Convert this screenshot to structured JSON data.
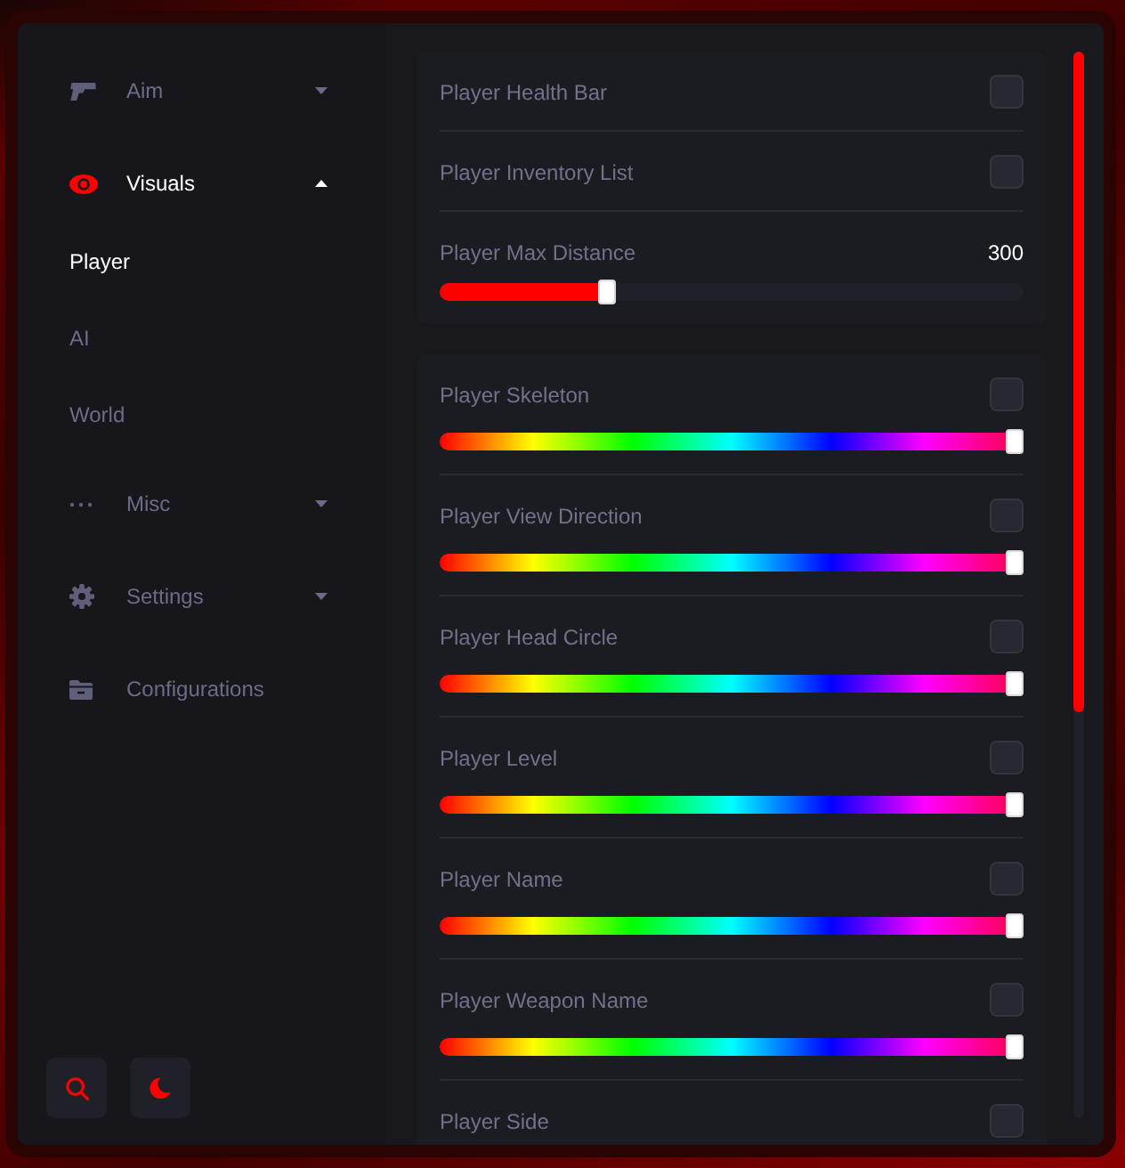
{
  "sidebar": {
    "items": [
      {
        "kind": "group",
        "label": "Aim",
        "selected": false,
        "expanded": false
      },
      {
        "kind": "group",
        "label": "Visuals",
        "selected": true,
        "expanded": true,
        "children": [
          {
            "label": "Player",
            "selected": true
          },
          {
            "label": "AI",
            "selected": false
          },
          {
            "label": "World",
            "selected": false
          }
        ]
      },
      {
        "kind": "group",
        "label": "Misc",
        "selected": false,
        "expanded": false
      },
      {
        "kind": "group",
        "label": "Settings",
        "selected": false,
        "expanded": false
      },
      {
        "kind": "link",
        "label": "Configurations",
        "selected": false
      }
    ]
  },
  "main": {
    "cards": [
      {
        "rows": [
          {
            "kind": "toggle",
            "label": "Player Health Bar",
            "checked": false
          },
          {
            "kind": "toggle",
            "label": "Player Inventory List",
            "checked": false
          },
          {
            "kind": "slider",
            "label": "Player Max Distance",
            "value": "300",
            "level": 0.28
          }
        ]
      },
      {
        "rows": [
          {
            "kind": "color",
            "label": "Player Skeleton",
            "checked": false,
            "level": 1
          },
          {
            "kind": "color",
            "label": "Player View Direction",
            "checked": false,
            "level": 1
          },
          {
            "kind": "color",
            "label": "Player Head Circle",
            "checked": false,
            "level": 1
          },
          {
            "kind": "color",
            "label": "Player Level",
            "checked": false,
            "level": 1
          },
          {
            "kind": "color",
            "label": "Player Name",
            "checked": false,
            "level": 1
          },
          {
            "kind": "color",
            "label": "Player Weapon Name",
            "checked": false,
            "level": 1
          },
          {
            "kind": "toggle",
            "label": "Player Side",
            "checked": false
          }
        ]
      }
    ]
  }
}
